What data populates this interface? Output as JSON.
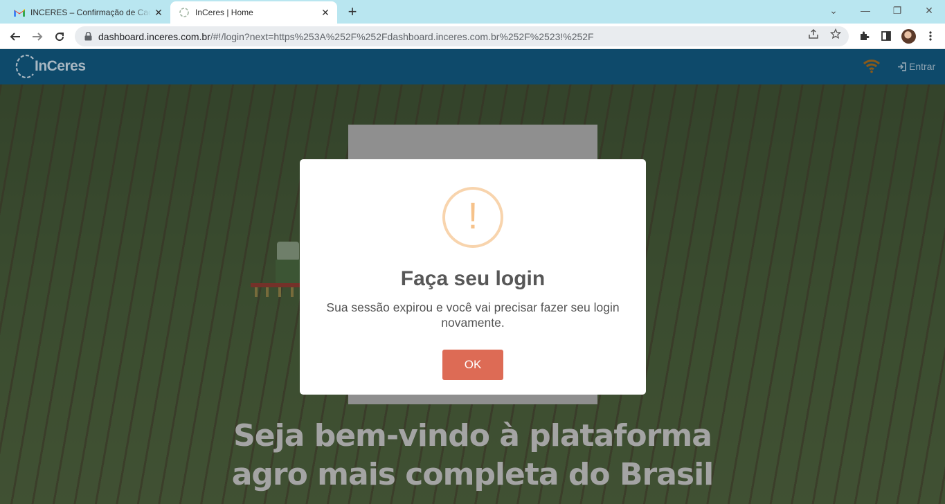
{
  "browser": {
    "tabs": [
      {
        "title": "INCERES – Confirmação de Cada",
        "favicon": "gmail-icon",
        "active": false
      },
      {
        "title": "InCeres | Home",
        "favicon": "inceres-icon",
        "active": true
      }
    ],
    "url": {
      "host": "dashboard.inceres.com.br",
      "path": "/#!/login?next=https%253A%252F%252Fdashboard.inceres.com.br%252F%2523!%252F"
    }
  },
  "site_header": {
    "logo_text": "InCeres",
    "login_label": "Entrar"
  },
  "page": {
    "headline_line1": "Seja bem-vindo à plataforma",
    "headline_line2": "agro mais completa do Brasil"
  },
  "modal": {
    "icon_mark": "!",
    "title": "Faça seu login",
    "message": "Sua sessão expirou e você vai precisar fazer seu login novamente.",
    "confirm_label": "OK"
  },
  "colors": {
    "header_bg": "#0e4a6b",
    "tabbar_bg": "#b9e6f0",
    "ok_button": "#dd6b55",
    "warning_ring": "#f8d4ad"
  }
}
